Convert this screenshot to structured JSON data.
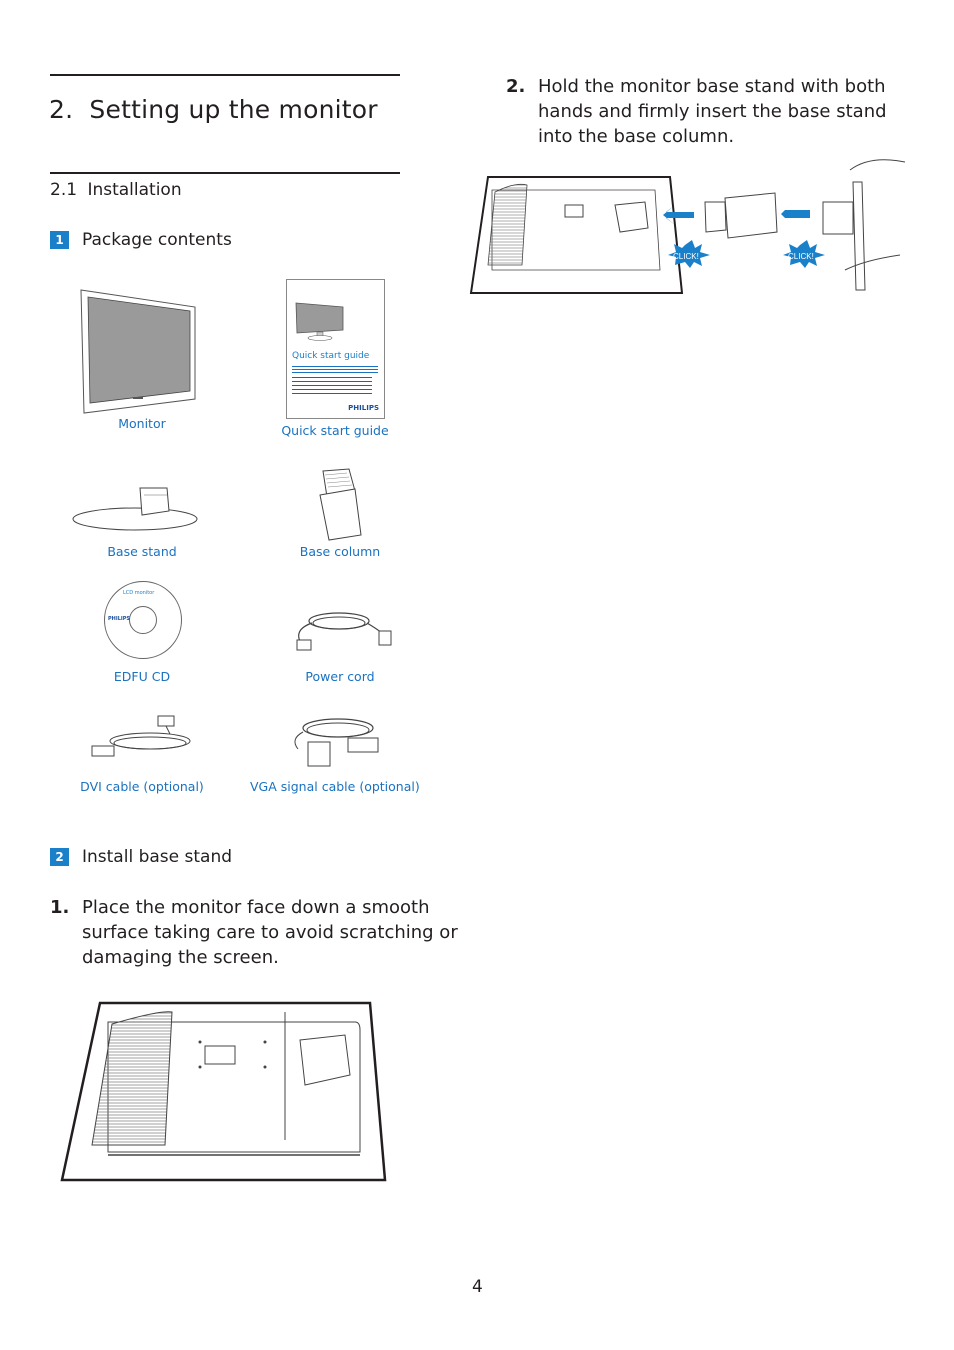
{
  "chapter": {
    "number": "2.",
    "title": "Setting up the monitor"
  },
  "section": {
    "number": "2.1",
    "title": "Installation"
  },
  "subsections": [
    {
      "badge": "1",
      "label": "Package contents"
    },
    {
      "badge": "2",
      "label": "Install base stand"
    }
  ],
  "package_contents": [
    {
      "label": "Monitor",
      "icon": "monitor-icon"
    },
    {
      "label": "Quick start guide",
      "icon": "quick-start-guide-icon"
    },
    {
      "label": "Base stand",
      "icon": "base-stand-icon"
    },
    {
      "label": "Base column",
      "icon": "base-column-icon"
    },
    {
      "label": "EDFU CD",
      "icon": "cd-icon"
    },
    {
      "label": "Power cord",
      "icon": "power-cord-icon"
    },
    {
      "label": "DVI cable (optional)",
      "icon": "dvi-cable-icon"
    },
    {
      "label": "VGA signal cable (optional)",
      "icon": "vga-cable-icon"
    }
  ],
  "guide_booklet": {
    "title": "Quick start guide",
    "brand": "PHILIPS"
  },
  "cd_label": {
    "title": "LCD monitor",
    "brand": "PHILIPS"
  },
  "steps": [
    {
      "number": "1.",
      "text": "Place the monitor face down a smooth surface taking care to avoid scratching or damaging the screen."
    },
    {
      "number": "2.",
      "text": "Hold the monitor base stand with both hands and firmly insert the base stand into the base column."
    }
  ],
  "illustration_labels": {
    "click_1": "CLICK!",
    "click_2": "CLICK!"
  },
  "colors": {
    "accent_blue": "#1a80c9",
    "caption_blue": "#1a72c0",
    "text": "#231f20"
  },
  "page_number": "4"
}
